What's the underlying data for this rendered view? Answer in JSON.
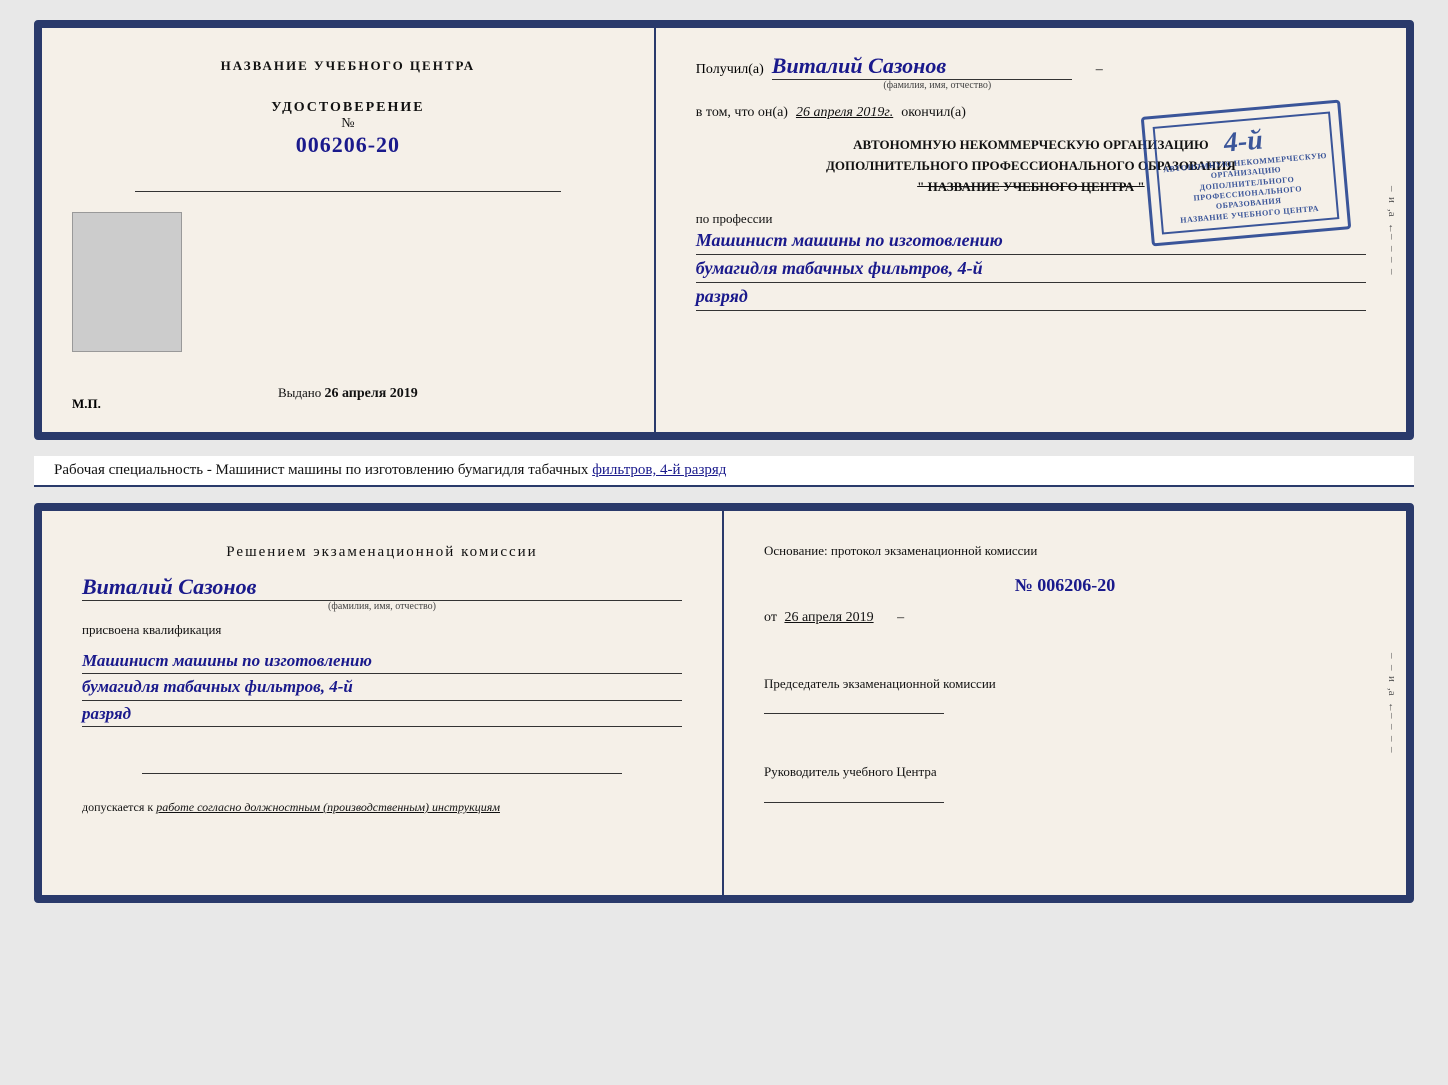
{
  "top_cert": {
    "left": {
      "title": "НАЗВАНИЕ УЧЕБНОГО ЦЕНТРА",
      "udost_label": "УДОСТОВЕРЕНИЕ",
      "number_prefix": "№",
      "number": "006206-20",
      "issued_label": "Выдано",
      "issued_date": "26 апреля 2019",
      "mp_label": "М.П."
    },
    "right": {
      "recipient_prefix": "Получил(а)",
      "recipient_name": "Виталий Сазонов",
      "recipient_sublabel": "(фамилия, имя, отчество)",
      "body_text_1": "в том, что он(а)",
      "body_date": "26 апреля 2019г.",
      "body_text_2": "окончил(а)",
      "org_line1": "АВТОНОМНУЮ НЕКОММЕРЧЕСКУЮ ОРГАНИЗАЦИЮ",
      "org_line2": "ДОПОЛНИТЕЛЬНОГО ПРОФЕССИОНАЛЬНОГО ОБРАЗОВАНИЯ",
      "org_name": "\" НАЗВАНИЕ УЧЕБНОГО ЦЕНТРА \"",
      "profession_prefix": "по профессии",
      "profession_line1": "Машинист машины по изготовлению",
      "profession_line2": "бумагидля табачных фильтров, 4-й",
      "profession_line3": "разряд",
      "stamp": {
        "number": "4-й",
        "line1": "АВТОНОМНУЮ НЕКОММЕРЧЕСКУЮ",
        "line2": "ОРГАНИЗАЦИЮ ДОПОЛНИТЕЛЬНОГО",
        "line3": "ПРОФЕССИОНАЛЬНОГО ОБРАЗОВАНИЯ",
        "line4": "НАЗВАНИЕ УЧЕБНОГО ЦЕНТРА"
      }
    }
  },
  "description": {
    "text": "Рабочая специальность - Машинист машины по изготовлению бумагидля табачных",
    "underlined": "фильтров, 4-й разряд"
  },
  "bottom": {
    "left": {
      "title": "Решением  экзаменационной  комиссии",
      "name": "Виталий Сазонов",
      "name_sublabel": "(фамилия, имя, отчество)",
      "assigned_label": "присвоена квалификация",
      "profession_line1": "Машинист машины по изготовлению",
      "profession_line2": "бумагидля табачных фильтров, 4-й",
      "profession_line3": "разряд",
      "allowed_label": "допускается к",
      "allowed_value": "работе согласно должностным (производственным) инструкциям"
    },
    "right": {
      "basis_label": "Основание: протокол экзаменационной  комиссии",
      "number_prefix": "№",
      "number": "006206-20",
      "date_prefix": "от",
      "date": "26 апреля 2019",
      "chairman_label": "Председатель экзаменационной комиссии",
      "director_label": "Руководитель учебного Центра"
    }
  },
  "edge_chars": [
    "и",
    "а",
    "←",
    "–",
    "–",
    "–",
    "–",
    "–"
  ]
}
